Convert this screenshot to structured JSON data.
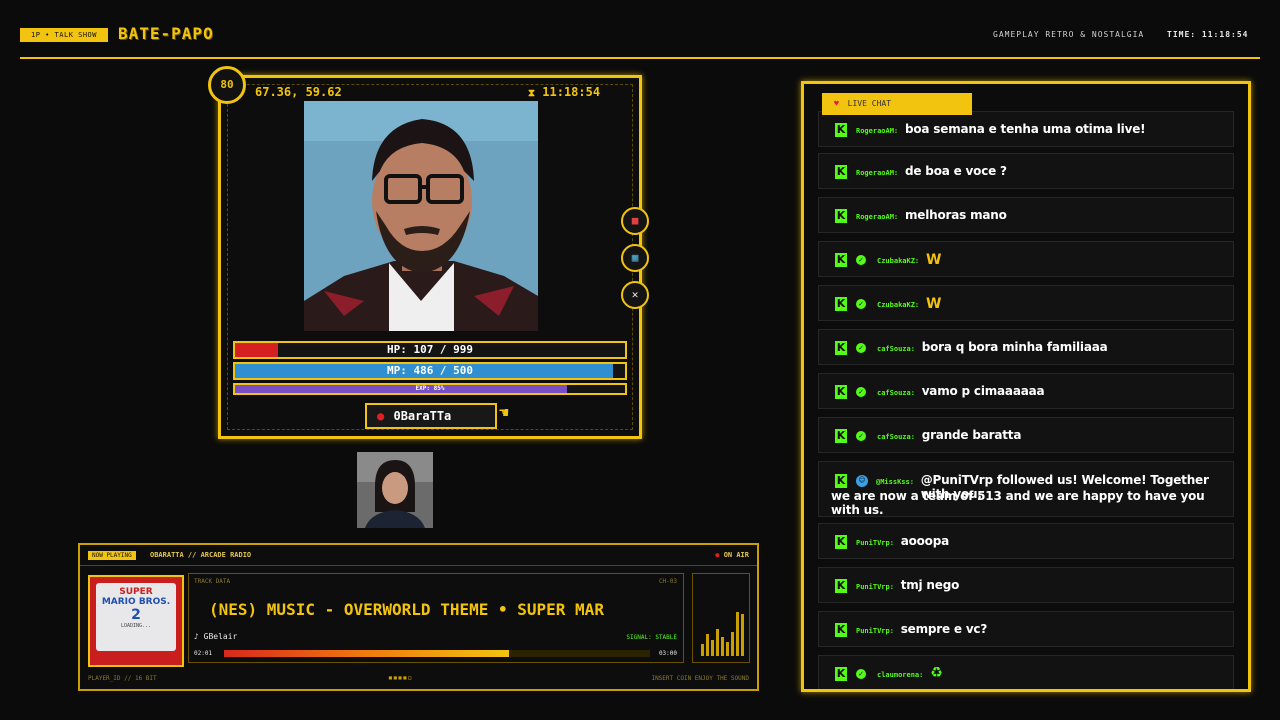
{
  "header": {
    "badge": "1P • TALK SHOW",
    "title": "BATE-PAPO",
    "subtitle": "GAMEPLAY RETRO & NOSTALGIA",
    "time_label": "TIME:",
    "time_value": "11:18:54"
  },
  "player": {
    "level": "80",
    "coords": "67.36, 59.62",
    "clock": "11:18:54",
    "hp_label": "HP: 107 / 999",
    "hp_fraction": 0.107,
    "mp_label": "MP: 486 / 500",
    "mp_fraction": 0.972,
    "exp_label": "EXP: 85%",
    "exp_fraction": 0.85,
    "name": "0BaraTTa",
    "side_buttons": [
      "backpack-icon",
      "map-icon",
      "close-icon"
    ]
  },
  "now_playing": {
    "badge": "NOW PLAYING",
    "title": "OBARATTA // ARCADE RADIO",
    "on_air": "ON AIR",
    "cover_line1": "SUPER",
    "cover_line2": "MARIO BROS.",
    "cover_num": "2",
    "cover_sub": "LOADING...",
    "track_label": "TRACK DATA",
    "channel": "CH-03",
    "marquee": "(NES) MUSIC - OVERWORLD THEME • SUPER MAR",
    "artist": "♪ GBelair",
    "signal": "SIGNAL: STABLE",
    "time_start": "02:01",
    "time_end": "03:00",
    "progress": 0.67,
    "footer_left": "PLAYER_ID // 16 BIT",
    "footer_right": "INSERT COIN  ENJOY THE SOUND"
  },
  "chat": {
    "tab_label": "LIVE CHAT",
    "messages": [
      {
        "user": "RogeraoAM:",
        "text": "boa semana e tenha uma otima live!",
        "verified": false
      },
      {
        "user": "RogeraoAM:",
        "text": "de boa e voce ?",
        "verified": false
      },
      {
        "user": "RogeraoAM:",
        "text": "melhoras mano",
        "verified": false
      },
      {
        "user": "CzubakaKZ:",
        "text": "W",
        "verified": true
      },
      {
        "user": "CzubakaKZ:",
        "text": "W",
        "verified": true
      },
      {
        "user": "cafSouza:",
        "text": "bora q bora minha familiaaa",
        "verified": true
      },
      {
        "user": "cafSouza:",
        "text": "vamo p cimaaaaaa",
        "verified": true
      },
      {
        "user": "cafSouza:",
        "text": "grande baratta",
        "verified": true
      },
      {
        "user": "@MissKss:",
        "text": "@PuniTVrp followed us! Welcome! Together with you,",
        "text2": "we are now a team of 513 and we are happy to have you with us.",
        "verified": false,
        "bot": true
      },
      {
        "user": "PuniTVrp:",
        "text": "aooopa",
        "verified": false
      },
      {
        "user": "PuniTVrp:",
        "text": "tmj nego",
        "verified": false
      },
      {
        "user": "PuniTVrp:",
        "text": "sempre e vc?",
        "verified": false
      },
      {
        "user": "claumorena:",
        "text": "",
        "verified": true,
        "emote": true
      }
    ]
  }
}
